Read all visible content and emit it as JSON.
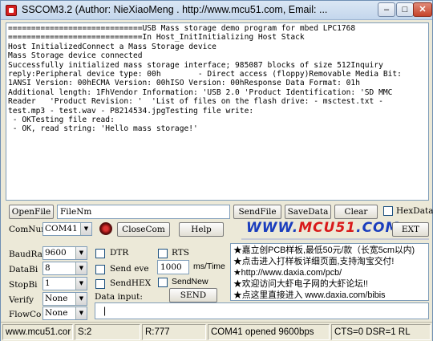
{
  "window": {
    "title": "SSCOM3.2 (Author: NieXiaoMeng .  http://www.mcu51.com, Email: ..."
  },
  "receive": {
    "lines": [
      "=============================USB Mass storage demo program for mbed LPC1768",
      "=============================In Host_InitInitializing Host Stack",
      "Host InitializedConnect a Mass Storage device",
      "Mass Storage device connected",
      "Successfully initialized mass storage interface; 985087 blocks of size 512Inquiry",
      "reply:Peripheral device type: 00h        - Direct access (floppy)Removable Media Bit:",
      "1ANSI Version: 00hECMA Version: 00hISO Version: 00hResponse Data Format: 01h",
      "Additional length: 1FhVendor Information: 'USB 2.0 'Product Identification: 'SD MMC",
      "Reader   'Product Revision: '  'List of files on the flash drive: - msctest.txt -",
      "test.mp3 - test.wav - P8214534.jpgTesting file write:",
      " - OKTesting file read:",
      " - OK, read string: 'Hello mass storage!'"
    ]
  },
  "file_row": {
    "open_file": "OpenFile",
    "file_name": "FileNm",
    "send_file": "SendFile",
    "save_data": "SaveData",
    "clear": "Clear",
    "hex_data": "HexData"
  },
  "com_row": {
    "com_num_label": "ComNum",
    "com_port": "COM41",
    "close_com": "CloseCom",
    "help": "Help",
    "ext": "EXT"
  },
  "logo": {
    "part1": "WWW.",
    "part2": "MCU51",
    "part3": ".COM"
  },
  "settings": {
    "baud_label": "BaudRa",
    "baud_value": "9600",
    "data_bits_label": "DataBi",
    "data_bits_value": "8",
    "stop_bits_label": "StopBi",
    "stop_bits_value": "1",
    "verify_label": "Verify",
    "verify_value": "None",
    "flow_label": "FlowCo",
    "flow_value": "None"
  },
  "options": {
    "dtr": "DTR",
    "rts": "RTS",
    "send_every": "Send eve",
    "interval": "1000",
    "ms_time": "ms/Time",
    "send_hex": "SendHEX",
    "send_new": "SendNew",
    "data_input": "Data input:",
    "send": "SEND"
  },
  "ad": {
    "lines": [
      "★嘉立创PCB样板,最低50元/款（长宽5cm以内)",
      "★点击进入打样板详细页面,支持淘宝交付!",
      "★http://www.daxia.com/pcb/",
      "★欢迎访问大虾电子网的大虾论坛!!",
      "★点这里直接进入 www.daxia.com/bibis"
    ]
  },
  "status": {
    "site": "www.mcu51.cor",
    "sent": "S:2",
    "received": "R:777",
    "port_state": "COM41 opened 9600bps",
    "signals": "CTS=0 DSR=1 RL"
  }
}
